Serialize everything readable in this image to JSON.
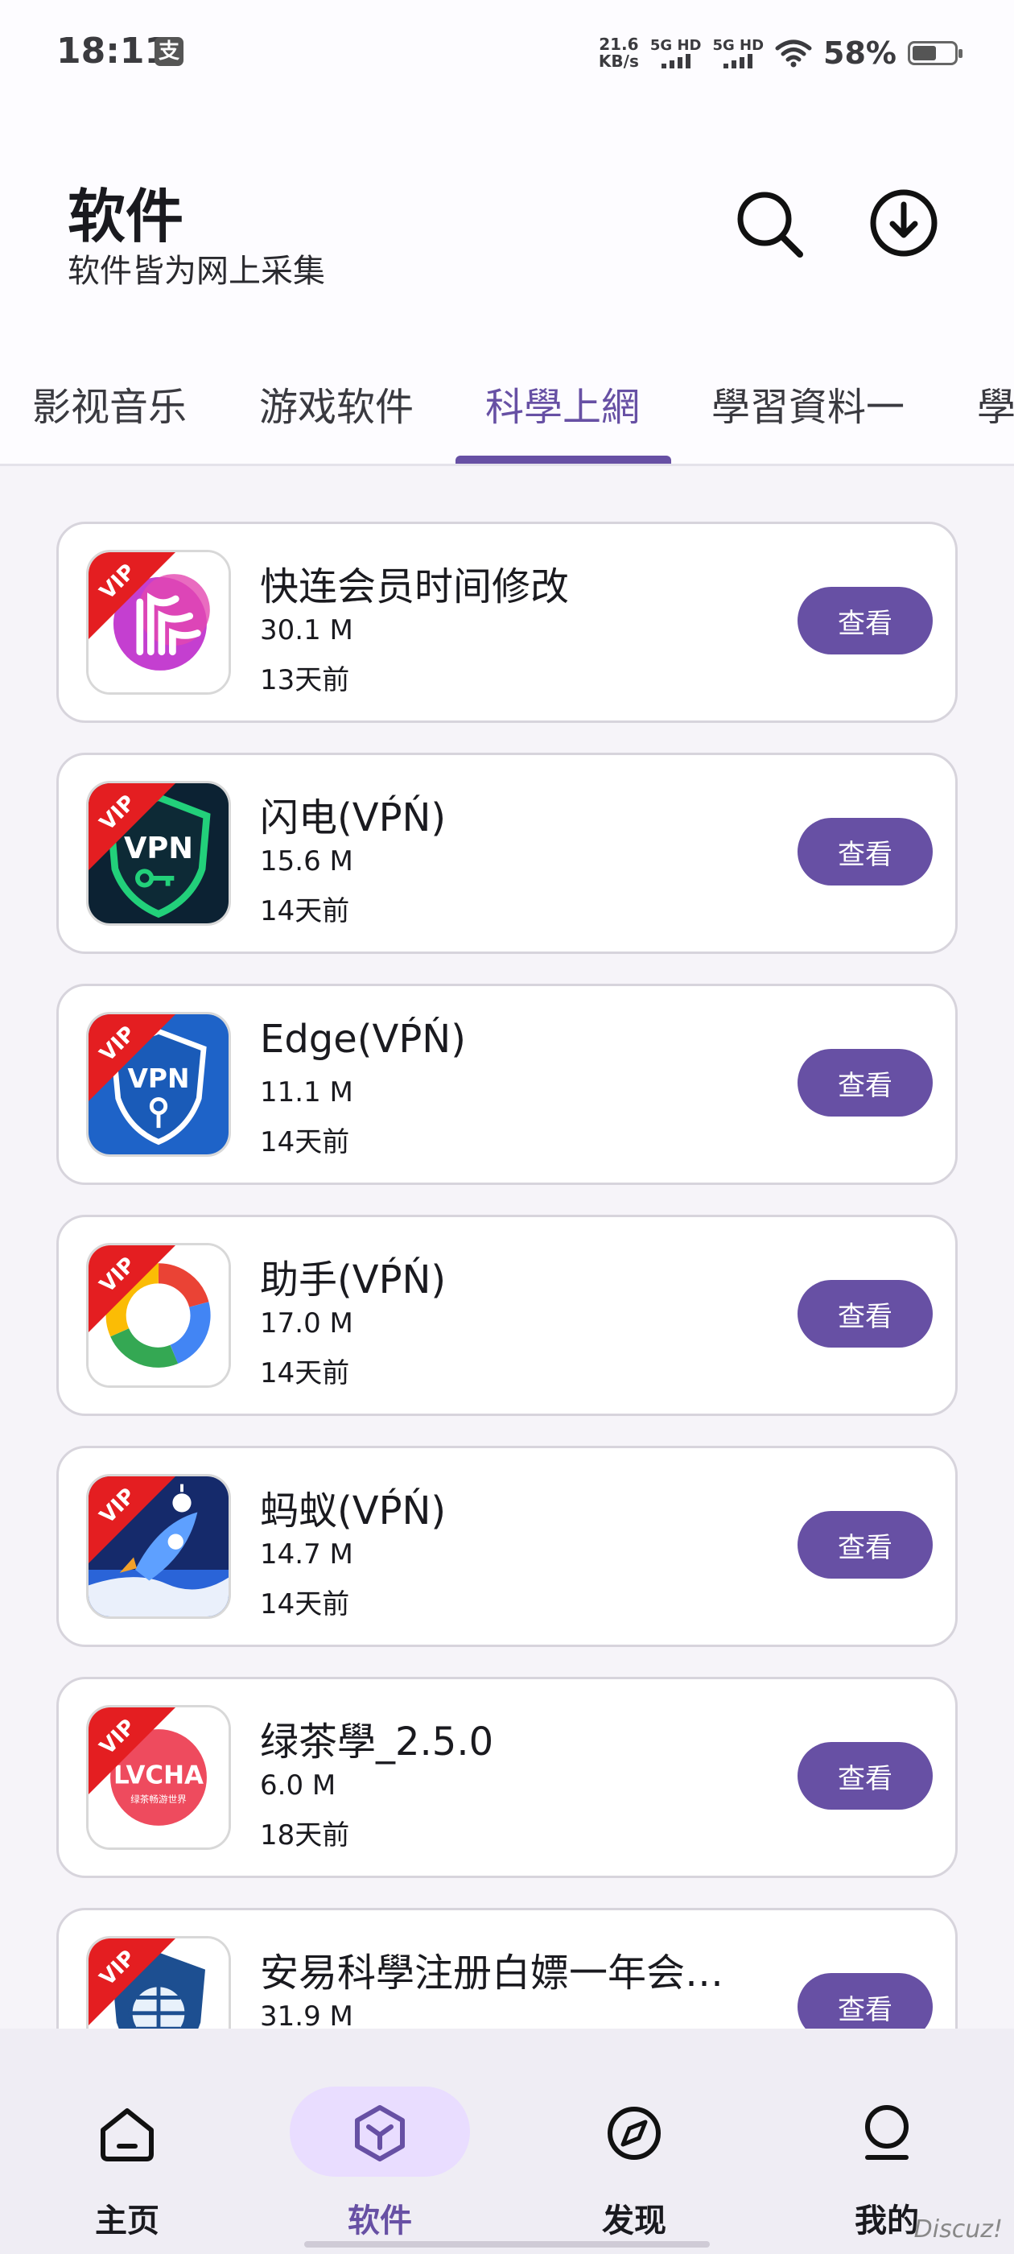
{
  "status_bar": {
    "time": "18:11",
    "badge": "支",
    "net_speed_value": "21.6",
    "net_speed_unit": "KB/s",
    "sim1_label": "5G HD",
    "sim2_label": "5G HD",
    "battery_percent": "58%",
    "battery_level": 0.58
  },
  "header": {
    "title": "软件",
    "subtitle": "软件皆为网上采集",
    "search_icon": "search-icon",
    "download_icon": "download-icon"
  },
  "tabs": [
    {
      "label": "影视音乐"
    },
    {
      "label": "游戏软件"
    },
    {
      "label": "科學上網",
      "active": true
    },
    {
      "label": "學習資料一"
    },
    {
      "label": "學"
    }
  ],
  "vip_label": "VIP",
  "apps": [
    {
      "name": "快连会员时间修改",
      "size": "30.1 M",
      "date": "13天前",
      "button": "查看",
      "icon": "letsvpn-icon"
    },
    {
      "name": "闪电(VṔŃ)",
      "size": "15.6 M",
      "date": "14天前",
      "button": "查看",
      "icon": "vpn-shield-green-icon",
      "icon_text": "VPN"
    },
    {
      "name": "Edge(VṔŃ)",
      "size": "11.1 M",
      "date": "14天前",
      "button": "查看",
      "icon": "vpn-shield-blue-icon",
      "icon_text": "VPN"
    },
    {
      "name": "助手(VṔŃ)",
      "size": "17.0 M",
      "date": "14天前",
      "button": "查看",
      "icon": "google-ring-icon"
    },
    {
      "name": "蚂蚁(VṔŃ)",
      "size": "14.7 M",
      "date": "14天前",
      "button": "查看",
      "icon": "rocket-icon"
    },
    {
      "name": "绿茶學_2.5.0",
      "size": "6.0 M",
      "date": "18天前",
      "button": "查看",
      "icon": "lvcha-icon",
      "icon_text": "LVCHA",
      "icon_subtext": "绿茶畅游世界"
    },
    {
      "name": "安易科學注册白嫖一年会…",
      "size": "31.9 M",
      "date": "",
      "button": "查看",
      "icon": "shield-globe-icon"
    }
  ],
  "bottom_nav": [
    {
      "label": "主页",
      "icon": "home-icon"
    },
    {
      "label": "软件",
      "icon": "cube-icon",
      "active": true
    },
    {
      "label": "发现",
      "icon": "compass-icon"
    },
    {
      "label": "我的",
      "icon": "profile-icon"
    }
  ],
  "watermark": "Discuz!",
  "colors": {
    "accent": "#6750a4",
    "vip_ribbon": "#e41e21",
    "card_border": "#d7d4dc"
  }
}
